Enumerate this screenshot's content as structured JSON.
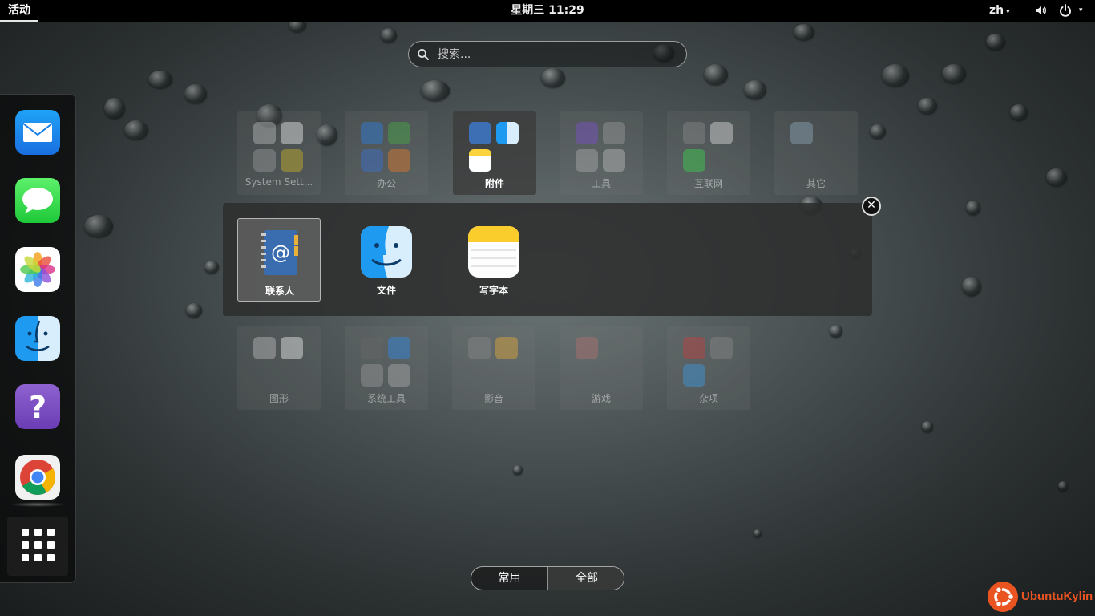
{
  "topbar": {
    "activities": "活动",
    "clock": "星期三 11:29",
    "language": "zh",
    "dropdown_glyph": "▾",
    "volume_icon": "volume-icon",
    "power_icon": "power-icon"
  },
  "search": {
    "placeholder": "搜索..."
  },
  "dock": {
    "apps": [
      "mail-icon",
      "messages-icon",
      "photos-icon",
      "finder-icon",
      "help-icon",
      "chrome-icon"
    ],
    "show_apps_icon": "grid-icon"
  },
  "folders": {
    "top": [
      "System Sett...",
      "办公",
      "附件",
      "工具",
      "互联网",
      "其它"
    ],
    "bottom": [
      "图形",
      "系统工具",
      "影音",
      "游戏",
      "杂项"
    ]
  },
  "popup": {
    "apps": [
      "联系人",
      "文件",
      "写字本"
    ],
    "close_glyph": "✕"
  },
  "view_switch": {
    "frequent": "常用",
    "all": "全部"
  },
  "branding": {
    "logo_text": "UbuntuKylin"
  },
  "colors": {
    "accent": "#e95420",
    "topbar": "#000000"
  }
}
